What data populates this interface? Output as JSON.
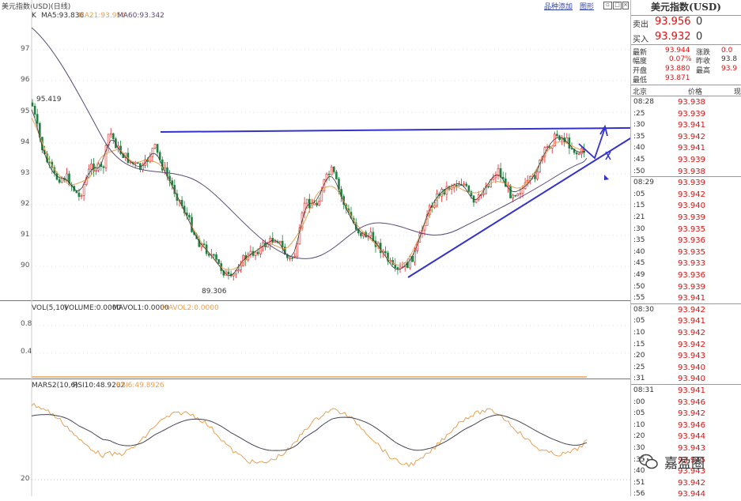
{
  "toolbar": {
    "title": "美元指数(USD)(日线)",
    "add_to_list": "品种添加",
    "window_close": "图形",
    "k_label": "K"
  },
  "main_legend": {
    "ma5": "MA5:93.836",
    "ma21": "MA21:93.954",
    "ma60": "MA60:93.342"
  },
  "main_y_ticks": [
    "97",
    "96",
    "95",
    "94",
    "93",
    "92",
    "91",
    "90"
  ],
  "annotations": {
    "high": "95.419",
    "low": "89.306"
  },
  "vol_legend": {
    "vol": "VOL(5,10)",
    "volume": "VOLUME:0.0000",
    "mavol1": "MAVOL1:0.0000",
    "mavol2": "MAVOL2:0.0000"
  },
  "vol_y_ticks": [
    "0.8",
    "0.4"
  ],
  "rsi_legend": {
    "mars": "MARS2(10,6)",
    "rsi10": "RSI10:48.9202",
    "rsi6": "RSI6:49.8926"
  },
  "rsi_y_ticks": [
    "20"
  ],
  "colors": {
    "ma5": "#3a3a3a",
    "ma21": "#e8a050",
    "ma60": "#5a4a7a",
    "up": "#e02020",
    "down": "#208040",
    "trend": "#3333cc"
  },
  "quote": {
    "title": "美元指数(USD)",
    "sell_label": "卖出",
    "sell_price": "93.956",
    "sell_qty": "0",
    "buy_label": "买入",
    "buy_price": "93.932",
    "buy_qty": "0",
    "latest_label": "最新",
    "latest": "93.944",
    "change_label": "涨跌",
    "change": "0.0",
    "amp_label": "幅度",
    "amp": "0.07%",
    "prev_label": "昨收",
    "prev": "93.8",
    "open_label": "开盘",
    "open": "93.880",
    "high_label": "最高",
    "high": "93.9",
    "low_label": "最低",
    "low": "93.871"
  },
  "ticks_header": {
    "city": "北京",
    "price": "价格",
    "extra": "现"
  },
  "ticks": [
    {
      "t": "08:28",
      "p": "93.938"
    },
    {
      "t": ":25",
      "p": "93.939"
    },
    {
      "t": ":30",
      "p": "93.941"
    },
    {
      "t": ":35",
      "p": "93.942"
    },
    {
      "t": ":40",
      "p": "93.941"
    },
    {
      "t": ":45",
      "p": "93.939"
    },
    {
      "t": ":50",
      "p": "93.938"
    },
    {
      "t": "08:29",
      "p": "93.939"
    },
    {
      "t": ":05",
      "p": "93.942"
    },
    {
      "t": ":15",
      "p": "93.940"
    },
    {
      "t": ":21",
      "p": "93.939"
    },
    {
      "t": ":30",
      "p": "93.935"
    },
    {
      "t": ":35",
      "p": "93.936"
    },
    {
      "t": ":40",
      "p": "93.935"
    },
    {
      "t": ":45",
      "p": "93.933"
    },
    {
      "t": ":49",
      "p": "93.936"
    },
    {
      "t": ":50",
      "p": "93.939"
    },
    {
      "t": ":55",
      "p": "93.941"
    },
    {
      "t": "08:30",
      "p": "93.942"
    },
    {
      "t": ":05",
      "p": "93.941"
    },
    {
      "t": ":10",
      "p": "93.942"
    },
    {
      "t": ":15",
      "p": "93.942"
    },
    {
      "t": ":20",
      "p": "93.943"
    },
    {
      "t": ":25",
      "p": "93.940"
    },
    {
      "t": ":31",
      "p": "93.940"
    },
    {
      "t": "08:31",
      "p": "93.941"
    },
    {
      "t": ":00",
      "p": "93.946"
    },
    {
      "t": ":05",
      "p": "93.942"
    },
    {
      "t": ":10",
      "p": "93.946"
    },
    {
      "t": ":20",
      "p": "93.944"
    },
    {
      "t": ":30",
      "p": "93.943"
    },
    {
      "t": ":35",
      "p": "93.945"
    },
    {
      "t": ":40",
      "p": "93.943"
    },
    {
      "t": ":51",
      "p": "93.942"
    },
    {
      "t": ":56",
      "p": "93.944"
    }
  ],
  "watermark": "嘉盈圈"
}
